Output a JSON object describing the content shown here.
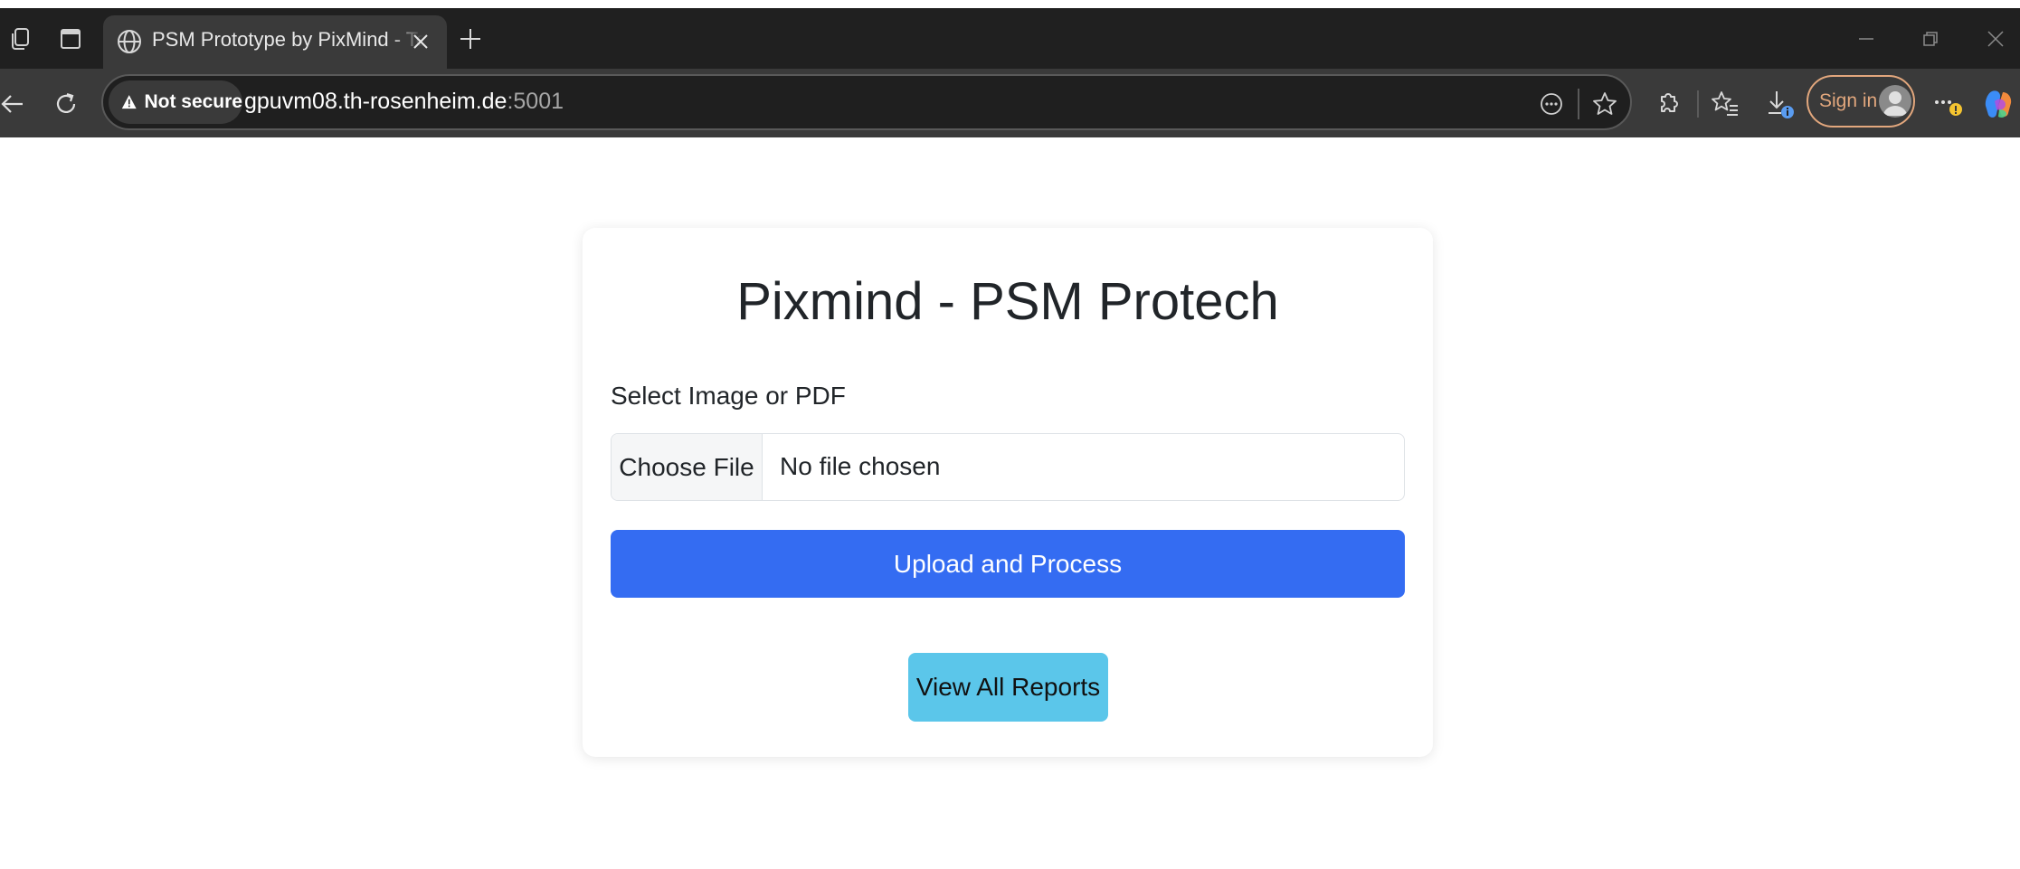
{
  "browser": {
    "tab_title": "PSM Prototype by PixMind - Team",
    "security_label": "Not secure",
    "url_host": "gpuvm08.th-rosenheim.de",
    "url_port": ":5001",
    "signin_label": "Sign in",
    "icons": {
      "workspaces": "workspaces-icon",
      "tab_actions": "tab-actions-icon",
      "site": "globe-icon",
      "close_tab": "close-icon",
      "new_tab": "plus-icon",
      "back": "back-arrow-icon",
      "refresh": "refresh-icon",
      "warning": "warning-triangle-icon",
      "reader": "reader-mode-icon",
      "favorite": "star-icon",
      "extensions": "extensions-icon",
      "favorites": "favorites-icon",
      "downloads": "download-icon",
      "profile": "avatar",
      "more": "more-icon",
      "copilot": "copilot-icon"
    }
  },
  "page": {
    "title": "Pixmind - PSM Protech",
    "file_label": "Select Image or PDF",
    "choose_file_label": "Choose File",
    "no_file_text": "No file chosen",
    "upload_button": "Upload and Process",
    "reports_button": "View All Reports"
  },
  "colors": {
    "primary": "#346cf2",
    "info": "#5bc6ea",
    "chrome_dark": "#202020",
    "chrome_toolbar": "#3a3a3a",
    "signin_accent": "#e2a77d"
  }
}
